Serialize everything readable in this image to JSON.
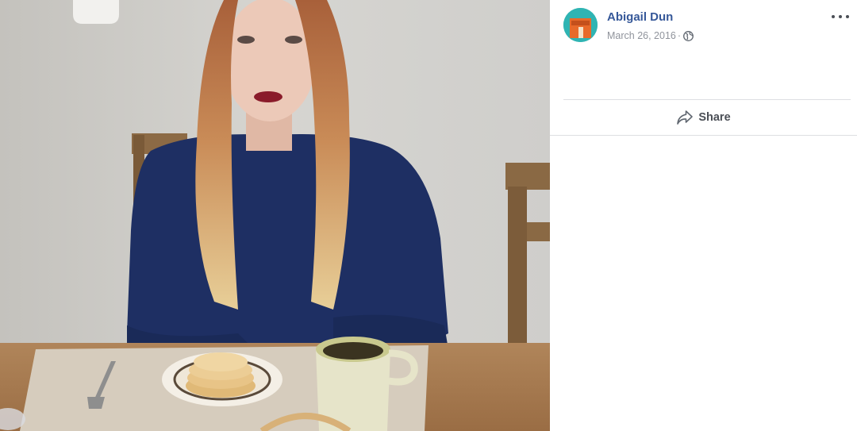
{
  "post": {
    "author": "Abigail Dun",
    "date": "March 26, 2016",
    "separator": "·",
    "privacy_icon": "globe-icon",
    "more_icon": "more-options-icon"
  },
  "actions": {
    "share_label": "Share",
    "share_icon": "share-arrow-icon"
  },
  "colors": {
    "author_link": "#365899",
    "meta_text": "#90949c",
    "divider": "#dddfe2",
    "action_text": "#4b4f56"
  }
}
